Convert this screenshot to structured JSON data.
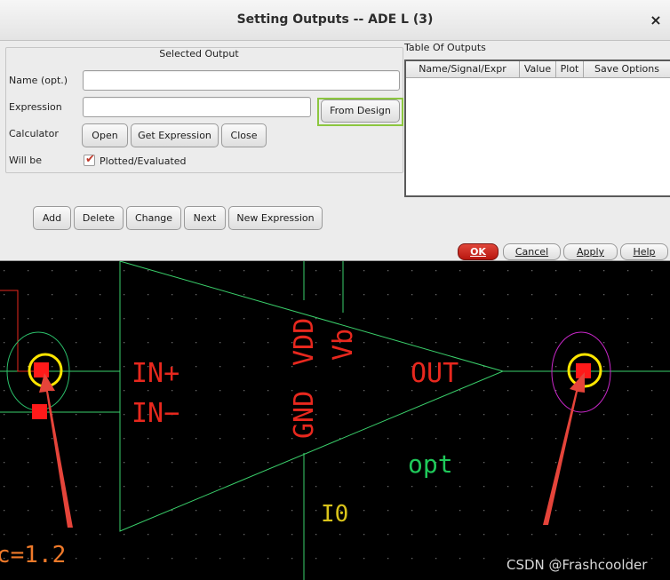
{
  "dialog": {
    "title": "Setting Outputs -- ADE L (3)",
    "close_glyph": "×",
    "selected_output": {
      "legend": "Selected Output",
      "name_label": "Name (opt.)",
      "name_value": "",
      "expression_label": "Expression",
      "expression_value": "",
      "from_design_label": "From Design",
      "calculator_label": "Calculator",
      "open_label": "Open",
      "get_expression_label": "Get Expression",
      "close_label": "Close",
      "will_be_label": "Will be",
      "plotted_label": "Plotted/Evaluated",
      "plotted_checked": true
    },
    "table": {
      "label": "Table Of Outputs",
      "columns": [
        "Name/Signal/Expr",
        "Value",
        "Plot",
        "Save Options"
      ],
      "rows": []
    },
    "actions": {
      "add": "Add",
      "delete": "Delete",
      "change": "Change",
      "next": "Next",
      "new_expression": "New Expression"
    },
    "footer": {
      "ok": "OK",
      "cancel": "Cancel",
      "apply": "Apply",
      "help": "Help"
    }
  },
  "schematic": {
    "pins": {
      "in_plus": "IN+",
      "in_minus": "IN−",
      "gnd": "GND",
      "vdd": "VDD",
      "vb": "Vb",
      "out": "OUT"
    },
    "param_opt": "opt",
    "instance_name": "I0",
    "partial_label": "c=1.2"
  },
  "watermark": "CSDN @Frashcoolder",
  "colors": {
    "pin_text": "#e8281e",
    "wire": "#3ad06b",
    "grid_dot": "#6b6b6b",
    "highlight_ring": "#ffe600",
    "arrow": "#e5443a",
    "input_halo": "#2bbf6a",
    "output_halo": "#c927c9",
    "opt_text": "#1fc95a",
    "instance_text": "#d9c31a",
    "partial_text": "#f07a2a",
    "from_design_outline": "#8cc63f"
  }
}
